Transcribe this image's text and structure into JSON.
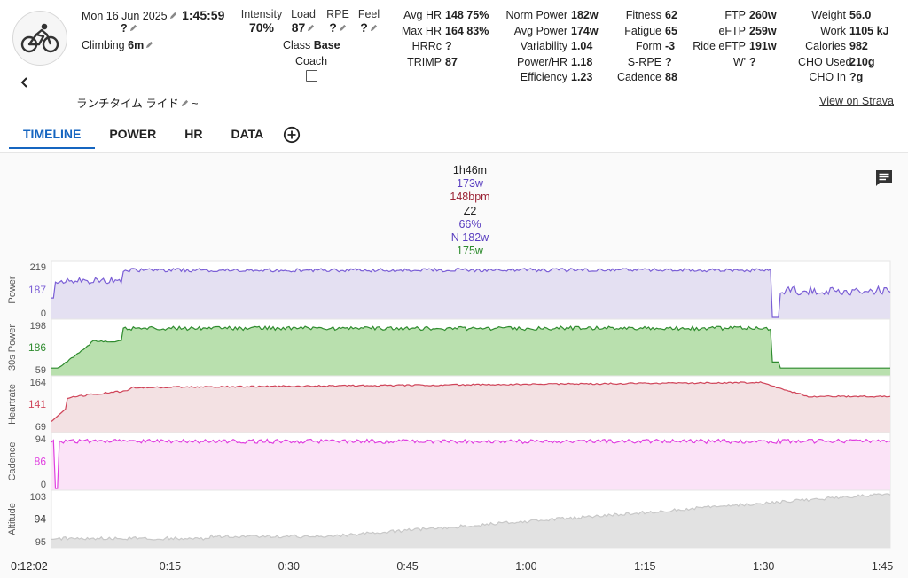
{
  "header": {
    "date": "Mon 16 Jun 2025",
    "duration": "1:45:59",
    "title_line": "?",
    "climbing_label": "Climbing",
    "climbing_value": "6m",
    "activity_name": "ランチタイム ライド",
    "activity_name_suffix": "~",
    "back_label": "<",
    "view_on_strava": "View on Strava"
  },
  "effort": {
    "intensity_label": "Intensity",
    "intensity_value": "70%",
    "load_label": "Load",
    "load_value": "87",
    "rpe_label": "RPE",
    "rpe_value": "?",
    "feel_label": "Feel",
    "feel_value": "?",
    "class_label": "Class",
    "class_value": "Base",
    "coach_label": "Coach"
  },
  "hr_stats": [
    {
      "label": "Avg HR",
      "value": "148 75%"
    },
    {
      "label": "Max HR",
      "value": "164 83%"
    },
    {
      "label": "HRRc",
      "value": "?"
    },
    {
      "label": "TRIMP",
      "value": "87"
    }
  ],
  "power_stats": [
    {
      "label": "Norm Power",
      "value": "182w"
    },
    {
      "label": "Avg Power",
      "value": "174w"
    },
    {
      "label": "Variability",
      "value": "1.04"
    },
    {
      "label": "Power/HR",
      "value": "1.18"
    },
    {
      "label": "Efficiency",
      "value": "1.23"
    }
  ],
  "fitness_stats": [
    {
      "label": "Fitness",
      "value": "62"
    },
    {
      "label": "Fatigue",
      "value": "65"
    },
    {
      "label": "Form",
      "value": "-3"
    },
    {
      "label": "S-RPE",
      "value": "?"
    },
    {
      "label": "Cadence",
      "value": "88"
    }
  ],
  "ftp_stats": [
    {
      "label": "FTP",
      "value": "260w"
    },
    {
      "label": "eFTP",
      "value": "259w"
    },
    {
      "label": "Ride eFTP",
      "value": "191w"
    },
    {
      "label": "W'",
      "value": "?"
    }
  ],
  "body_stats": [
    {
      "label": "Weight",
      "value": "56.0"
    },
    {
      "label": "Work",
      "value": "1105 kJ"
    },
    {
      "label": "Calories",
      "value": "982"
    },
    {
      "label": "CHO Used",
      "value": "210g"
    },
    {
      "label": "CHO In",
      "value": "?g"
    }
  ],
  "tabs": [
    {
      "label": "TIMELINE",
      "active": true
    },
    {
      "label": "POWER",
      "active": false
    },
    {
      "label": "HR",
      "active": false
    },
    {
      "label": "DATA",
      "active": false
    }
  ],
  "summary": {
    "duration": "1h46m",
    "avg_power": "173w",
    "avg_hr": "148bpm",
    "zone": "Z2",
    "intensity": "66%",
    "norm_power": "N 182w",
    "thirty_s": "175w"
  },
  "lanes": [
    {
      "name": "Power",
      "max": "219",
      "avg": "187",
      "min": "0",
      "color": "#7b5fd6",
      "fill": "#e4e0f2"
    },
    {
      "name": "30s Power",
      "max": "198",
      "avg": "186",
      "min": "59",
      "color": "#2e8b2e",
      "fill": "#b9e0ae",
      "fill2": "#b9ddd3"
    },
    {
      "name": "Heartrate",
      "max": "164",
      "avg": "141",
      "min": "69",
      "color": "#d0455a",
      "fill": "#f3e1e3"
    },
    {
      "name": "Cadence",
      "max": "94",
      "avg": "86",
      "min": "0",
      "color": "#e040e0",
      "fill": "#fbe3f7"
    },
    {
      "name": "Altitude",
      "max": "103",
      "avg": "94",
      "min": "95",
      "color": "#c8c8c8",
      "fill": "#e2e2e2"
    }
  ],
  "x_axis": {
    "cursor_time": "0:12:02",
    "ticks": [
      "0:15",
      "0:30",
      "0:45",
      "1:00",
      "1:15",
      "1:30",
      "1:45"
    ]
  },
  "colors": {
    "accent": "#1565c0",
    "power": "#7b5fd6",
    "hr": "#d0455a",
    "cadence": "#e040e0",
    "thirty_s_power": "#2e8b2e"
  },
  "icons": {
    "avatar": "cycling-icon",
    "comment": "comment-icon",
    "add_tab": "add-circle-icon",
    "edit": "pencil-icon"
  }
}
